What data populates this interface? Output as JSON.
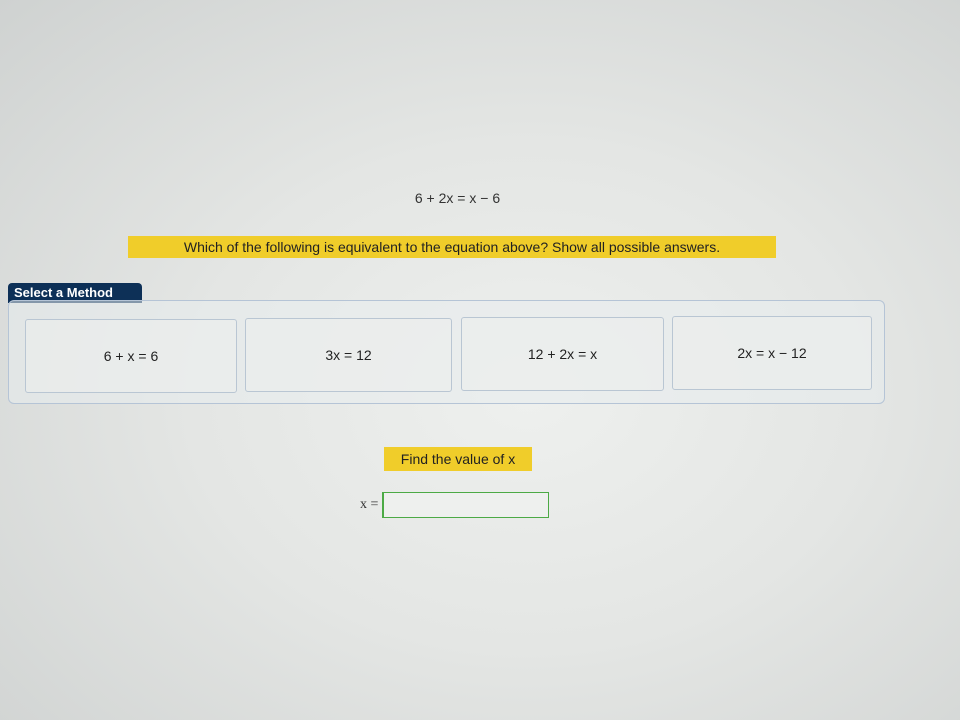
{
  "question": {
    "equation": "6 + 2x = x − 6",
    "prompt": "Which of the following is equivalent to the equation above? Show all possible answers."
  },
  "method_panel": {
    "tab_label": "Select a Method",
    "options": [
      {
        "label": "6 + x = 6"
      },
      {
        "label": "3x = 12"
      },
      {
        "label": "12 + 2x = x"
      },
      {
        "label": "2x = x − 12"
      }
    ]
  },
  "answer": {
    "prompt": "Find the value of x",
    "input_label": "x =",
    "input_value": ""
  },
  "colors": {
    "highlight": "#f0cd2a",
    "tab_background": "#0d3057",
    "input_border": "#4caa45"
  }
}
